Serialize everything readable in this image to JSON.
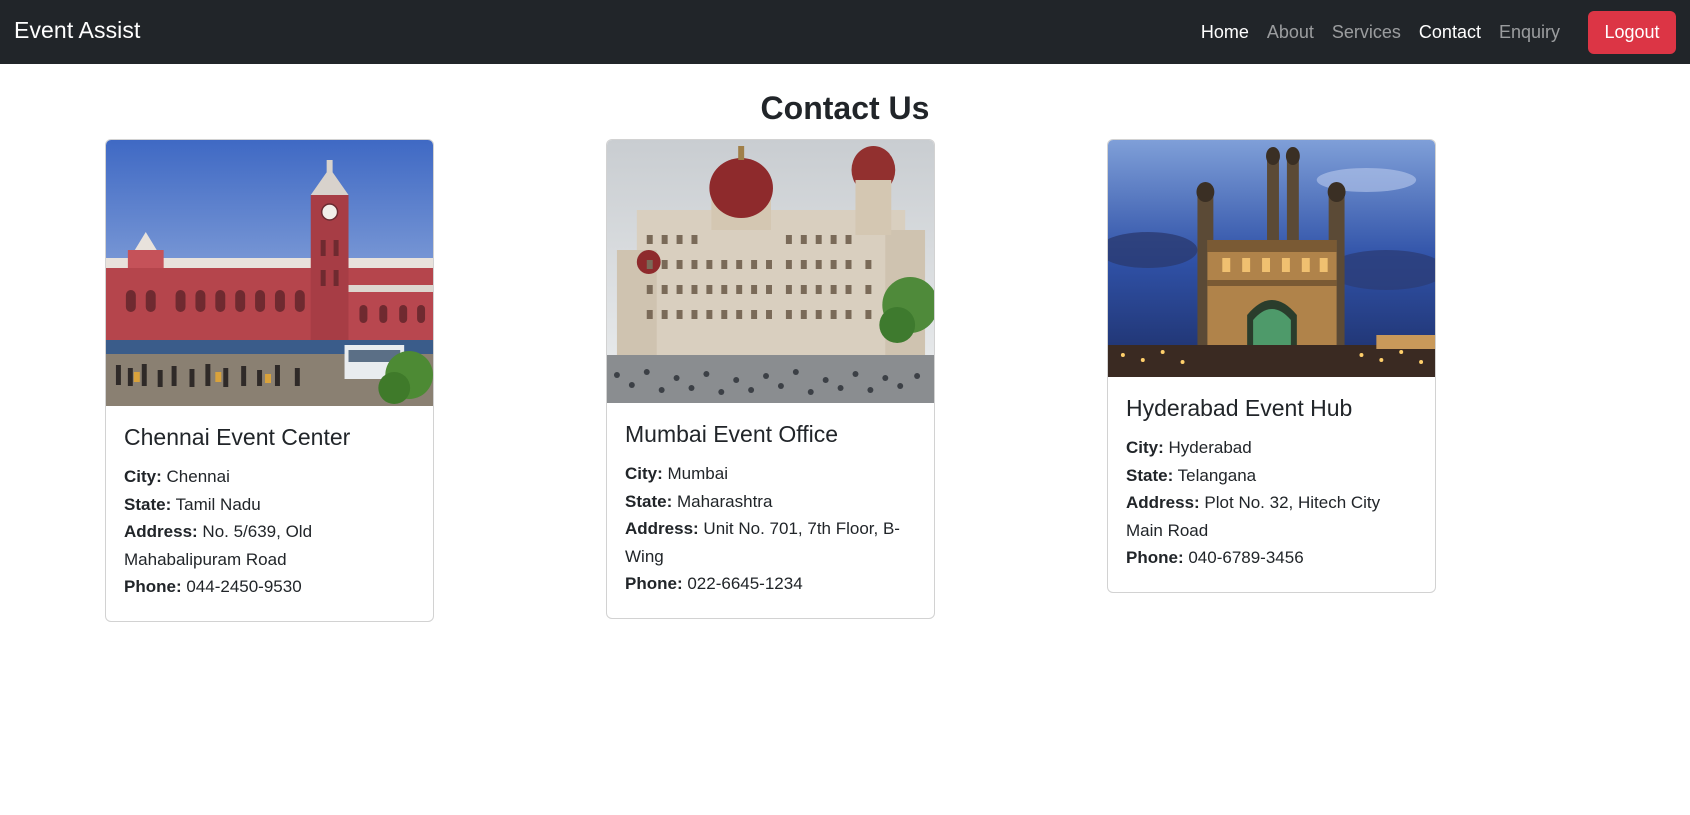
{
  "navbar": {
    "brand": "Event Assist",
    "links": [
      {
        "label": "Home",
        "active": true
      },
      {
        "label": "About",
        "active": false
      },
      {
        "label": "Services",
        "active": false
      },
      {
        "label": "Contact",
        "active": true
      },
      {
        "label": "Enquiry",
        "active": false
      }
    ],
    "logout_label": "Logout",
    "colors": {
      "background": "#212529",
      "logout": "#dc3545"
    }
  },
  "page": {
    "title": "Contact Us"
  },
  "labels": {
    "city": "City:",
    "state": "State:",
    "address": "Address:",
    "phone": "Phone:"
  },
  "cards": [
    {
      "title": "Chennai Event Center",
      "image": "chennai-central-station-photo",
      "city": "Chennai",
      "state": "Tamil Nadu",
      "address": "No. 5/639, Old Mahabalipuram Road",
      "phone": "044-2450-9530"
    },
    {
      "title": "Mumbai Event Office",
      "image": "taj-mahal-palace-photo",
      "city": "Mumbai",
      "state": "Maharashtra",
      "address": "Unit No. 701, 7th Floor, B-Wing",
      "phone": "022-6645-1234"
    },
    {
      "title": "Hyderabad Event Hub",
      "image": "charminar-night-photo",
      "city": "Hyderabad",
      "state": "Telangana",
      "address": "Plot No. 32, Hitech City Main Road",
      "phone": "040-6789-3456"
    }
  ]
}
